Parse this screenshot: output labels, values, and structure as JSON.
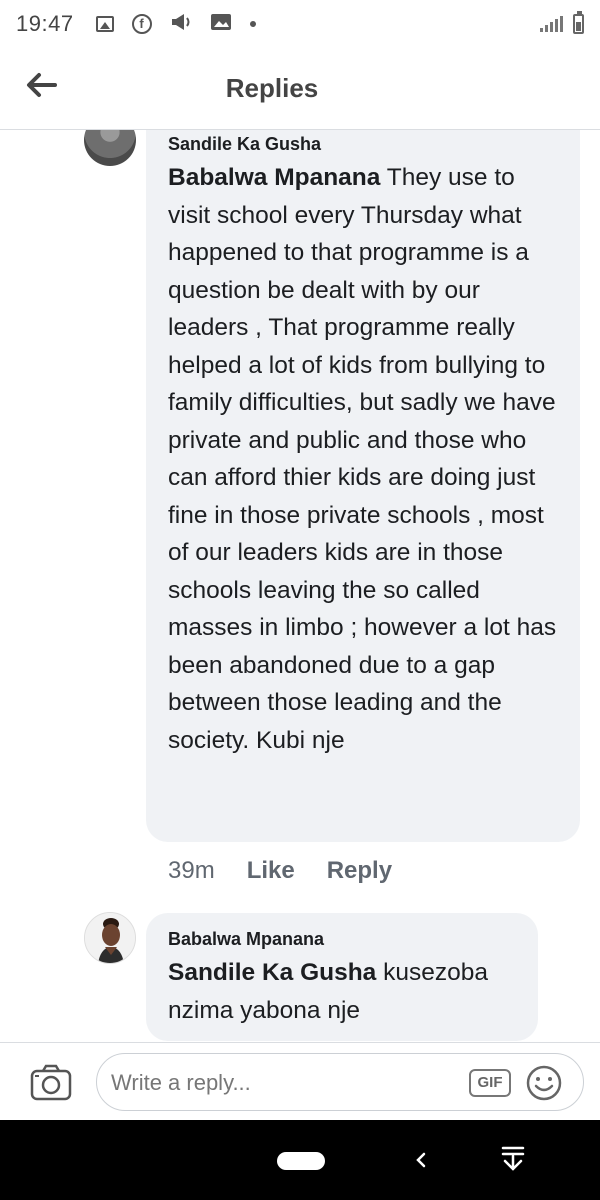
{
  "status_bar": {
    "time": "19:47",
    "icons": [
      "image-icon",
      "facebook-icon",
      "megaphone-icon",
      "photo-icon",
      "dot-icon",
      "signal-icon",
      "battery-icon"
    ]
  },
  "header": {
    "title": "Replies",
    "back_icon": "arrow-left-icon"
  },
  "comments": [
    {
      "author": "Sandile Ka Gusha",
      "mention": "Babalwa Mpanana",
      "text": " They use to visit school every Thursday what happened to that programme is a question be dealt with by our leaders , That programme really helped a lot of kids from bullying to family difficulties,  but sadly we have private and public and those who can afford thier kids are doing just fine in those private schools , most of our leaders kids are in those schools leaving the so called masses in limbo ; however a lot has been abandoned due to a gap between those leading and the society. Kubi nje",
      "time": "39m",
      "like_label": "Like",
      "reply_label": "Reply"
    },
    {
      "author": "Babalwa Mpanana",
      "mention": "Sandile Ka Gusha",
      "text": " kusezoba nzima yabona nje"
    }
  ],
  "composer": {
    "placeholder": "Write a reply...",
    "gif_label": "GIF",
    "camera_icon": "camera-icon",
    "emoji_icon": "emoji-icon"
  },
  "colors": {
    "bubble": "#f0f2f5",
    "meta_text": "#606770",
    "nav_bar": "#000000"
  }
}
